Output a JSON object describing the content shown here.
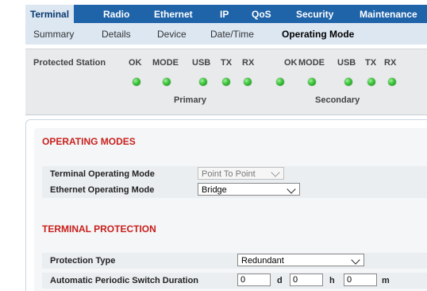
{
  "topnav": {
    "tabs": [
      "Terminal",
      "Radio",
      "Ethernet",
      "IP",
      "QoS",
      "Security",
      "Maintenance"
    ]
  },
  "subnav": {
    "items": [
      "Summary",
      "Details",
      "Device",
      "Date/Time",
      "Operating Mode"
    ],
    "active": "Operating Mode"
  },
  "status": {
    "title": "Protected Station",
    "headers": [
      "OK",
      "MODE",
      "USB",
      "TX",
      "RX",
      "OK",
      "MODE",
      "USB",
      "TX",
      "RX"
    ],
    "primary_label": "Primary",
    "secondary_label": "Secondary",
    "led_color": "#3cc23a"
  },
  "operating_modes": {
    "title": "OPERATING MODES",
    "terminal_mode_label": "Terminal Operating Mode",
    "terminal_mode_value": "Point To Point",
    "ethernet_mode_label": "Ethernet Operating Mode",
    "ethernet_mode_value": "Bridge"
  },
  "terminal_protection": {
    "title": "TERMINAL PROTECTION",
    "protection_type_label": "Protection Type",
    "protection_type_value": "Redundant",
    "switch_duration_label": "Automatic Periodic Switch Duration",
    "days_value": "0",
    "days_unit": "d",
    "hours_value": "0",
    "hours_unit": "h",
    "minutes_value": "0",
    "minutes_unit": "m"
  },
  "colors": {
    "nav_bg": "#1f63a8",
    "subnav_bg": "#dce7f2",
    "section_title": "#c8201c"
  }
}
